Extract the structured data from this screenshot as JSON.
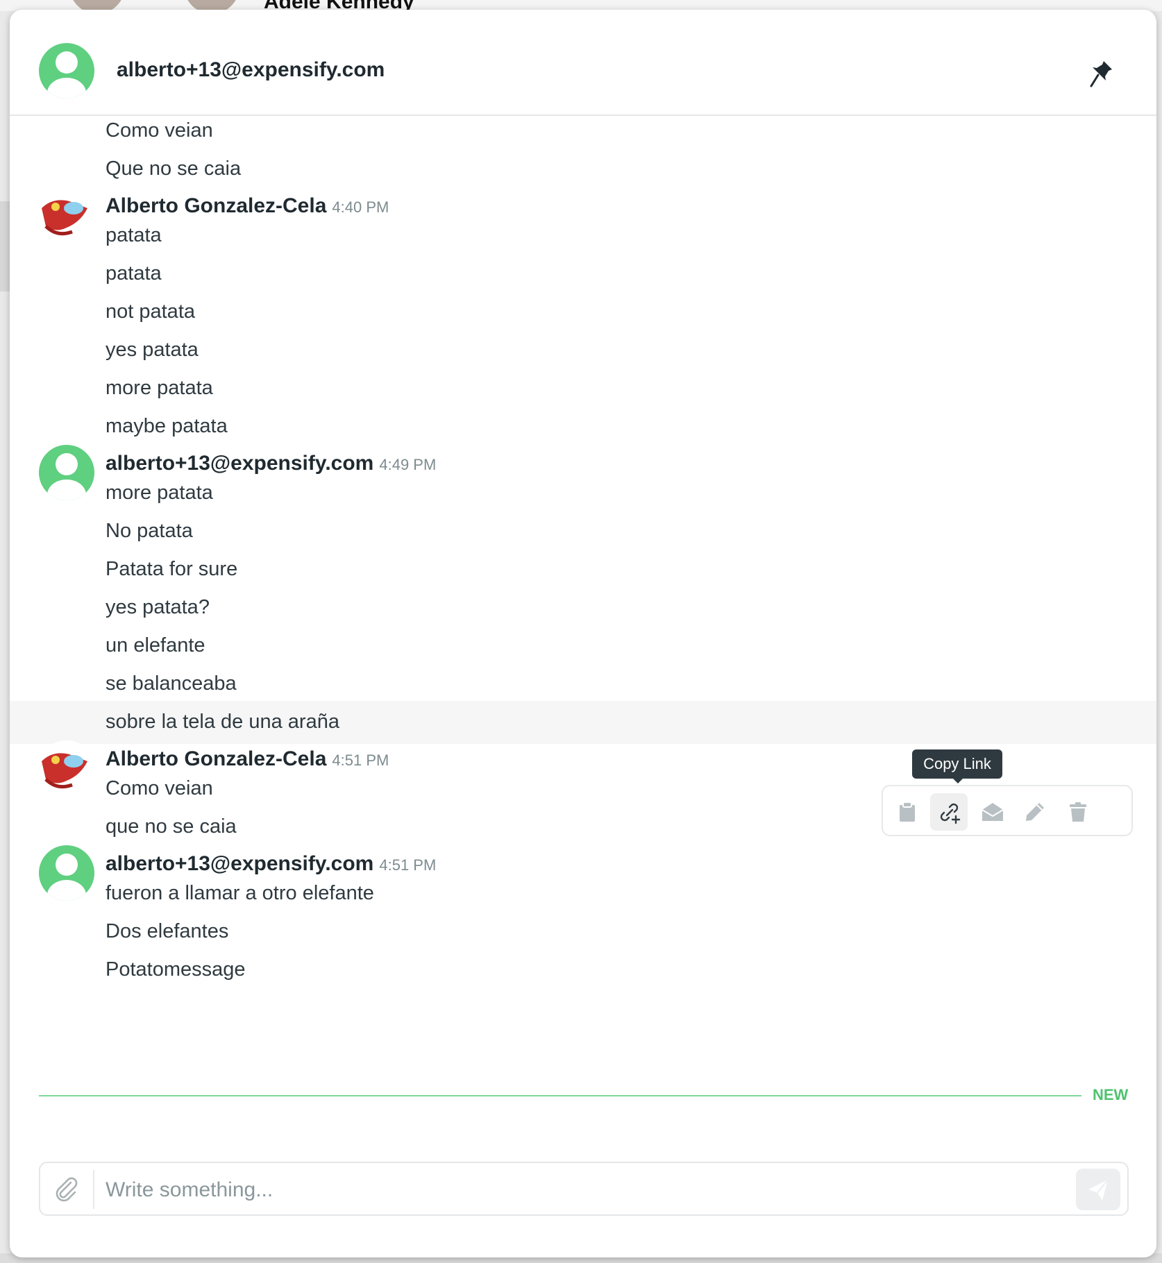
{
  "background": {
    "partial_name": "Adele Kennedy"
  },
  "header": {
    "title": "alberto+13@expensify.com"
  },
  "messages": [
    {
      "type": "cont",
      "text": "Como veian"
    },
    {
      "type": "cont",
      "text": "Que no se caia"
    },
    {
      "type": "head",
      "sender": "Alberto Gonzalez-Cela",
      "time": "4:40 PM",
      "avatar": "photo",
      "text": "patata"
    },
    {
      "type": "cont",
      "text": "patata"
    },
    {
      "type": "cont",
      "text": "not patata"
    },
    {
      "type": "cont",
      "text": "yes patata"
    },
    {
      "type": "cont",
      "text": "more patata"
    },
    {
      "type": "cont",
      "text": "maybe patata"
    },
    {
      "type": "head",
      "sender": "alberto+13@expensify.com",
      "time": "4:49 PM",
      "avatar": "default",
      "text": "more patata"
    },
    {
      "type": "cont",
      "text": "No patata"
    },
    {
      "type": "cont",
      "text": "Patata for sure"
    },
    {
      "type": "cont",
      "text": "yes patata?"
    },
    {
      "type": "cont",
      "text": "un elefante"
    },
    {
      "type": "cont",
      "text": "se balanceaba"
    },
    {
      "type": "cont",
      "text": "sobre la tela de una araña",
      "hovered": true
    },
    {
      "type": "head",
      "sender": "Alberto Gonzalez-Cela",
      "time": "4:51 PM",
      "avatar": "photo",
      "text": "Como veian"
    },
    {
      "type": "cont",
      "text": "que no se caia"
    },
    {
      "type": "head",
      "sender": "alberto+13@expensify.com",
      "time": "4:51 PM",
      "avatar": "default",
      "text": "fueron a llamar a otro elefante"
    },
    {
      "type": "cont",
      "text": "Dos elefantes"
    },
    {
      "type": "cont",
      "text": "Potatomessage"
    }
  ],
  "hover_toolbar": {
    "tooltip": "Copy Link",
    "actions": [
      "clipboard-icon",
      "link-icon",
      "mail-open-icon",
      "pencil-icon",
      "trash-icon"
    ]
  },
  "new_marker": {
    "label": "NEW"
  },
  "composer": {
    "placeholder": "Write something...",
    "value": ""
  },
  "colors": {
    "accent": "#5fcf80",
    "new_label": "#4fc36f",
    "tooltip_bg": "#2f3a40"
  }
}
